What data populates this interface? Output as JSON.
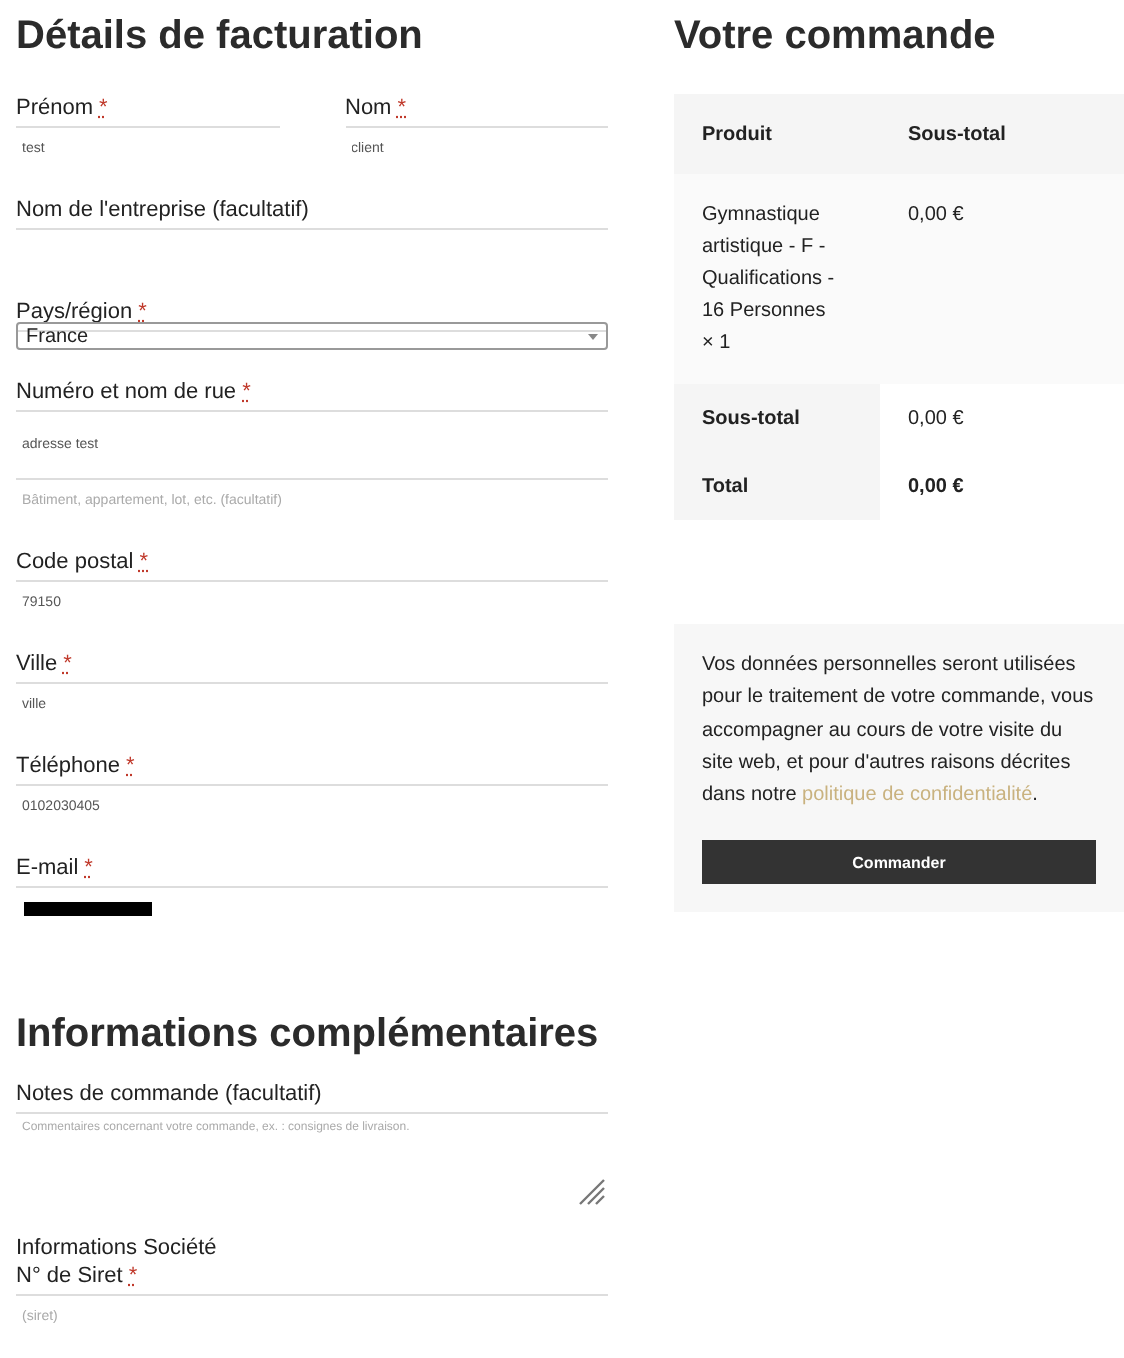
{
  "billing": {
    "title": "Détails de facturation",
    "rows": [
      [
        {
          "kind": "text",
          "label": "Prénom",
          "required": true,
          "value": "test"
        },
        {
          "kind": "text",
          "label": "Nom",
          "required": true,
          "value": "client"
        }
      ],
      [
        {
          "kind": "text",
          "label": "Nom de l'entreprise (facultatif)",
          "required": false
        }
      ],
      [
        {
          "kind": "select",
          "label": "Pays/région",
          "required": true,
          "value": "France"
        }
      ],
      [
        {
          "kind": "address",
          "label": "Numéro et nom de rue",
          "required": true,
          "value": "adresse test",
          "placeholder": "Bâtiment, appartement, lot, etc. (facultatif)"
        }
      ],
      [
        {
          "kind": "text",
          "label": "Code postal",
          "required": true,
          "value": "79150"
        }
      ],
      [
        {
          "kind": "text",
          "label": "Ville",
          "required": true,
          "value": "ville"
        }
      ],
      [
        {
          "kind": "text",
          "label": "Téléphone",
          "required": true,
          "value": "0102030405"
        }
      ],
      [
        {
          "kind": "redacted",
          "label": "E-mail",
          "required": true
        }
      ]
    ],
    "required_mark": "*"
  },
  "additional": {
    "title": "Informations complémentaires",
    "notes_label": "Notes de commande (facultatif)",
    "notes_placeholder": "Commentaires concernant votre commande, ex. : consignes de livraison.",
    "company_heading": "Informations Société",
    "siret_label": "N° de Siret",
    "siret_required": true,
    "siret_placeholder": "(siret)"
  },
  "order": {
    "title": "Votre commande",
    "columns": [
      "Produit",
      "Sous-total"
    ],
    "items": [
      {
        "name": "Gymnastique artistique - F - Qualifications - 16 Personnes",
        "qty": "× 1",
        "subtotal": "0,00 €"
      }
    ],
    "totals": [
      {
        "label": "Sous-total",
        "value": "0,00 €"
      },
      {
        "label": "Total",
        "value": "0,00 €"
      }
    ],
    "privacy_text": "Vos données personnelles seront utilisées pour le traitement de votre commande, vous accompagner au cours de votre visite du site web, et pour d'autres raisons décrites dans notre",
    "privacy_link": "politique de confidentialité",
    "privacy_end": ".",
    "button": "Commander"
  }
}
